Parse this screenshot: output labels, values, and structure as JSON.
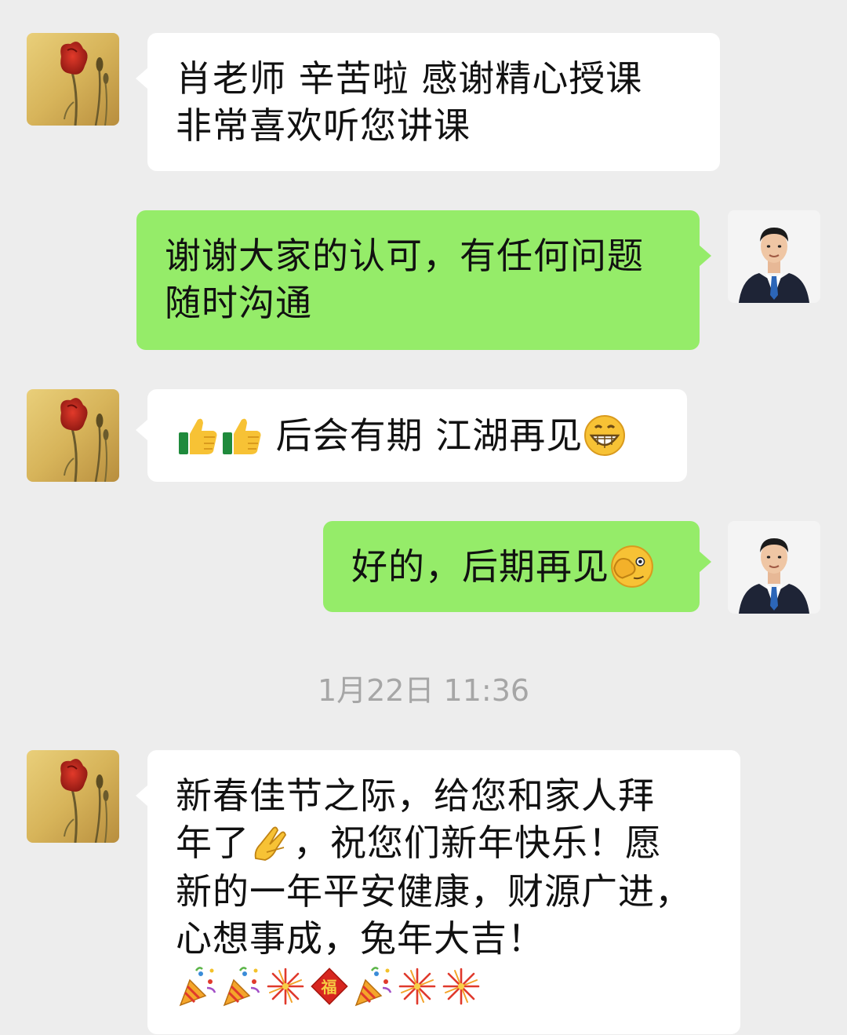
{
  "conversation": {
    "messages": [
      {
        "sender": "contact",
        "lines": [
          "肖老师 辛苦啦  感谢精心授课",
          "非常喜欢听您讲课"
        ]
      },
      {
        "sender": "me",
        "lines": [
          "谢谢大家的认可，有任何问题",
          "随时沟通"
        ]
      },
      {
        "sender": "contact",
        "text": "后会有期  江湖再见",
        "emojis": [
          "thumbs-up-icon",
          "thumbs-up-icon",
          "grinning-face-icon"
        ]
      },
      {
        "sender": "me",
        "text": "好的，后期再见",
        "emojis": [
          "face-peeking-icon"
        ]
      },
      {
        "sender": "contact",
        "lines": [
          "新春佳节之际，给您和家人拜",
          "，祝您们新年快乐！愿",
          "新的一年平安健康，财源广进，",
          "心想事成，兔年大吉！"
        ],
        "line2_prefix": "年了",
        "emojis": [
          "pinched-hands-icon",
          "party-popper-icon",
          "party-popper-icon",
          "fireworks-icon",
          "fu-icon",
          "party-popper-icon",
          "fireworks-icon",
          "fireworks-icon"
        ]
      }
    ],
    "timestamp": "1月22日 11:36"
  },
  "colors": {
    "background": "#ededed",
    "incoming_bubble": "#ffffff",
    "outgoing_bubble": "#95ec69",
    "timestamp_text": "#a6a6a6"
  }
}
